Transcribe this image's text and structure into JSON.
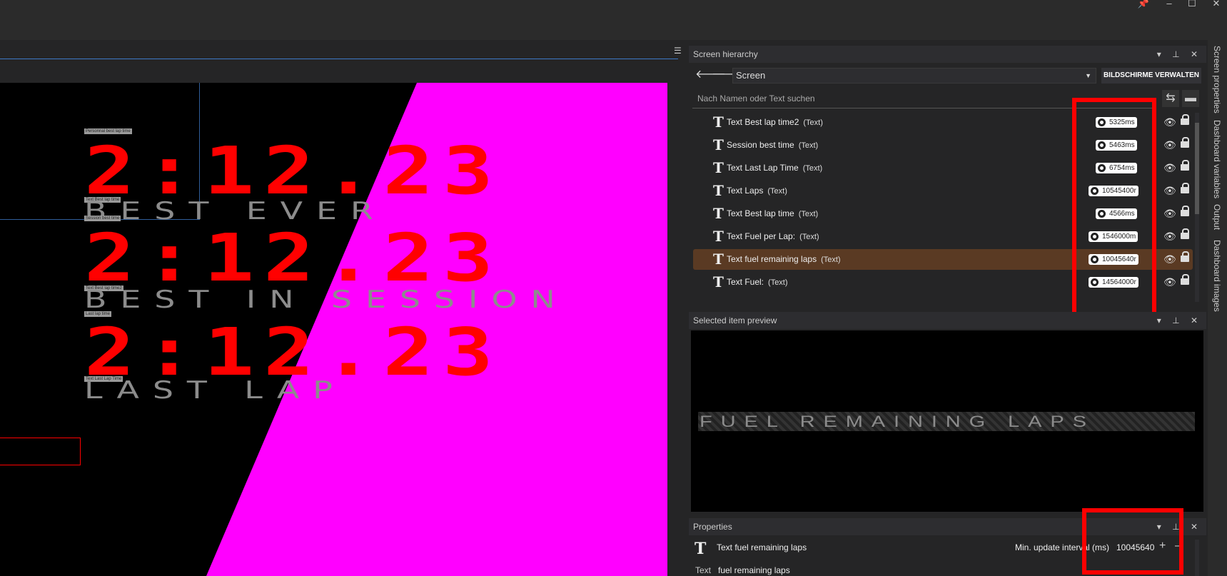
{
  "titlebar": {
    "pin": "📌",
    "minimize": "–",
    "maximize": "☐",
    "close": "✕"
  },
  "canvas": {
    "time1": "2:12.23",
    "time2": "2:12.23",
    "time3": "2:12.23",
    "caption1": "BEST EVER",
    "caption2": "BEST IN SESSION",
    "caption3": "LAST LAP",
    "tags": [
      "Personnal best lap time",
      "Text Best lap time",
      "Session best time",
      "Text Best lap time2",
      "Last lap time",
      "Text Last Lap Time"
    ]
  },
  "hierarchy": {
    "title": "Screen hierarchy",
    "screen_select": "Screen",
    "manage_button": "BILDSCHIRME VERWALTEN",
    "search_placeholder": "Nach Namen oder Text suchen",
    "rows": [
      {
        "name": "Text Best lap time2",
        "kind": "(Text)",
        "interval": "5325ms",
        "selected": false
      },
      {
        "name": "Session best time",
        "kind": "(Text)",
        "interval": "5463ms",
        "selected": false
      },
      {
        "name": "Text Last Lap Time",
        "kind": "(Text)",
        "interval": "6754ms",
        "selected": false
      },
      {
        "name": "Text Laps",
        "kind": "(Text)",
        "interval": "10545400r",
        "selected": false
      },
      {
        "name": "Text Best lap time",
        "kind": "(Text)",
        "interval": "4566ms",
        "selected": false
      },
      {
        "name": "Text Fuel per Lap:",
        "kind": "(Text)",
        "interval": "1546000m",
        "selected": false
      },
      {
        "name": "Text fuel remaining laps",
        "kind": "(Text)",
        "interval": "10045640r",
        "selected": true
      },
      {
        "name": "Text Fuel:",
        "kind": "(Text)",
        "interval": "14564000r",
        "selected": false
      }
    ]
  },
  "preview": {
    "title": "Selected item preview",
    "text": "FUEL REMAINING LAPS"
  },
  "properties": {
    "title": "Properties",
    "item_name": "Text fuel remaining laps",
    "interval_label": "Min. update interval (ms)",
    "interval_value": "10045640",
    "text_label": "Text",
    "text_value": "fuel remaining laps"
  },
  "side_tabs": [
    "Screen properties",
    "Dashboard variables",
    "Output",
    "Dashboard images"
  ],
  "colors": {
    "accent": "#3d79c6",
    "highlight": "#ff0000",
    "selected_row": "#5a3a23",
    "magenta": "#ff00ff"
  }
}
